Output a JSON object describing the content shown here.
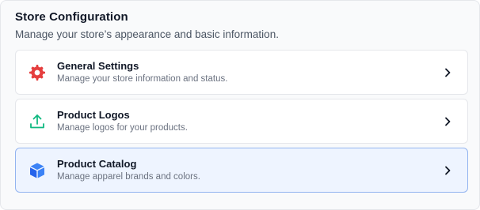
{
  "header": {
    "title": "Store Configuration",
    "subtitle": "Manage your store’s appearance and basic information."
  },
  "cards": [
    {
      "title": "General Settings",
      "description": "Manage your store information and status.",
      "icon": "gear-icon",
      "icon_color": "#e53e3e",
      "selected": false
    },
    {
      "title": "Product Logos",
      "description": "Manage logos for your products.",
      "icon": "upload-icon",
      "icon_color": "#10b981",
      "selected": false
    },
    {
      "title": "Product Catalog",
      "description": "Manage apparel brands and colors.",
      "icon": "cube-icon",
      "icon_color": "#3b82f6",
      "selected": true
    }
  ],
  "colors": {
    "selected_bg": "#eef4ff",
    "selected_border": "#93b4f0"
  }
}
